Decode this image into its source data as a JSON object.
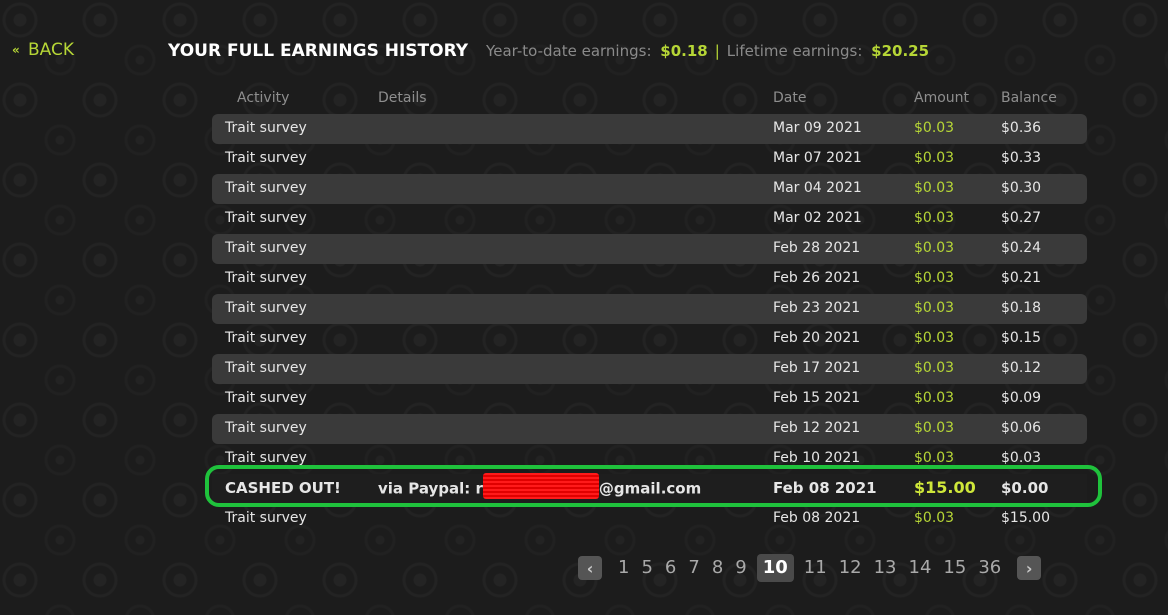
{
  "back": {
    "label": "BACK",
    "icon": "double-chevron-left-icon"
  },
  "header": {
    "title": "YOUR FULL EARNINGS HISTORY",
    "ytd_label": "Year-to-date earnings:",
    "ytd_value": "$0.18",
    "separator": "|",
    "lifetime_label": "Lifetime earnings:",
    "lifetime_value": "$20.25"
  },
  "table": {
    "columns": [
      "Activity",
      "Details",
      "Date",
      "Amount",
      "Balance"
    ],
    "rows": [
      {
        "activity": "Trait survey",
        "details": "",
        "date": "Mar 09 2021",
        "amount": "$0.03",
        "balance": "$0.36"
      },
      {
        "activity": "Trait survey",
        "details": "",
        "date": "Mar 07 2021",
        "amount": "$0.03",
        "balance": "$0.33"
      },
      {
        "activity": "Trait survey",
        "details": "",
        "date": "Mar 04 2021",
        "amount": "$0.03",
        "balance": "$0.30"
      },
      {
        "activity": "Trait survey",
        "details": "",
        "date": "Mar 02 2021",
        "amount": "$0.03",
        "balance": "$0.27"
      },
      {
        "activity": "Trait survey",
        "details": "",
        "date": "Feb 28 2021",
        "amount": "$0.03",
        "balance": "$0.24"
      },
      {
        "activity": "Trait survey",
        "details": "",
        "date": "Feb 26 2021",
        "amount": "$0.03",
        "balance": "$0.21"
      },
      {
        "activity": "Trait survey",
        "details": "",
        "date": "Feb 23 2021",
        "amount": "$0.03",
        "balance": "$0.18"
      },
      {
        "activity": "Trait survey",
        "details": "",
        "date": "Feb 20 2021",
        "amount": "$0.03",
        "balance": "$0.15"
      },
      {
        "activity": "Trait survey",
        "details": "",
        "date": "Feb 17 2021",
        "amount": "$0.03",
        "balance": "$0.12"
      },
      {
        "activity": "Trait survey",
        "details": "",
        "date": "Feb 15 2021",
        "amount": "$0.03",
        "balance": "$0.09"
      },
      {
        "activity": "Trait survey",
        "details": "",
        "date": "Feb 12 2021",
        "amount": "$0.03",
        "balance": "$0.06"
      },
      {
        "activity": "Trait survey",
        "details": "",
        "date": "Feb 10 2021",
        "amount": "$0.03",
        "balance": "$0.03"
      }
    ],
    "cashout": {
      "activity": "CASHED OUT!",
      "details_prefix": "via Paypal: r",
      "details_suffix": "@gmail.com",
      "date": "Feb 08 2021",
      "amount": "$15.00",
      "balance": "$0.00"
    },
    "last_row": {
      "activity": "Trait survey",
      "details": "",
      "date": "Feb 08 2021",
      "amount": "$0.03",
      "balance": "$15.00"
    }
  },
  "pagination": {
    "prev_icon": "chevron-left-icon",
    "next_icon": "chevron-right-icon",
    "pages": [
      "1",
      "5",
      "6",
      "7",
      "8",
      "9",
      "10",
      "11",
      "12",
      "13",
      "14",
      "15",
      "36"
    ],
    "current": "10"
  },
  "colors": {
    "accent": "#b6d636",
    "highlight_border": "#1fc23c",
    "redaction": "#ff1a1a",
    "row_shade": "#3a3a3a"
  }
}
